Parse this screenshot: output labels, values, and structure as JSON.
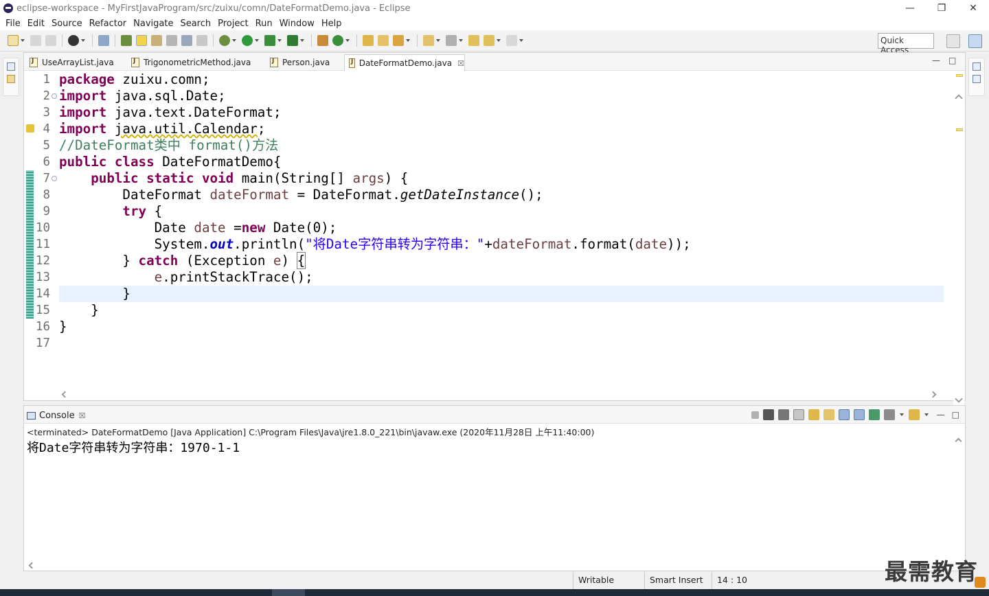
{
  "window": {
    "title": "eclipse-workspace - MyFirstJavaProgram/src/zuixu/comn/DateFormatDemo.java - Eclipse",
    "minimize": "—",
    "restore": "❐",
    "close": "✕"
  },
  "menu": [
    "File",
    "Edit",
    "Source",
    "Refactor",
    "Navigate",
    "Search",
    "Project",
    "Run",
    "Window",
    "Help"
  ],
  "toolbar": {
    "quick_access_placeholder": "Quick Access"
  },
  "editor": {
    "tabs": [
      {
        "label": "UseArrayList.java",
        "active": false
      },
      {
        "label": "TrigonometricMethod.java",
        "active": false
      },
      {
        "label": "Person.java",
        "active": false
      },
      {
        "label": "DateFormatDemo.java",
        "active": true
      }
    ],
    "tab_close": "☒",
    "minimize": "—",
    "maximize": "□",
    "line_numbers": [
      "1",
      "2",
      "3",
      "4",
      "5",
      "6",
      "7",
      "8",
      "9",
      "10",
      "11",
      "12",
      "13",
      "14",
      "15",
      "16",
      "17"
    ],
    "code": {
      "l1": {
        "kw": "package",
        "rest": " zuixu.comn;"
      },
      "l2": {
        "kw": "import",
        "rest": " java.sql.Date;"
      },
      "l3": {
        "kw": "import",
        "rest": " java.text.DateFormat;"
      },
      "l4": {
        "kw": "import",
        "warn": "java.util.Calendar",
        "rest": ";"
      },
      "l5": {
        "comment": "//DateFormat类中 format()方法"
      },
      "l6": {
        "kw1": "public",
        "kw2": "class",
        "rest": " DateFormatDemo{"
      },
      "l7": {
        "indent": "    ",
        "kw1": "public",
        "kw2": "static",
        "kw3": "void",
        "a": " main(String[] ",
        "var": "args",
        "b": ") {"
      },
      "l8": {
        "indent": "        ",
        "type": "DateFormat ",
        "var": "dateFormat",
        "eq": " = DateFormat.",
        "method": "getDateInstance",
        "end": "();"
      },
      "l9": {
        "indent": "        ",
        "kw": "try",
        "rest": " {"
      },
      "l10": {
        "indent": "            ",
        "type": "Date ",
        "var": "date",
        "eq": " =",
        "kw": "new",
        "rest": " Date(0);"
      },
      "l11": {
        "indent": "            ",
        "a": "System.",
        "fld": "out",
        "b": ".println(",
        "str": "\"将Date字符串转为字符串：\"",
        "c": "+",
        "var1": "dateFormat",
        "d": ".format(",
        "var2": "date",
        "e": "));"
      },
      "l12": {
        "indent": "        ",
        "a": "} ",
        "kw": "catch",
        "b": " (Exception ",
        "var": "e",
        "c": ") ",
        "brk": "{"
      },
      "l13": {
        "indent": "            ",
        "var": "e",
        "rest": ".printStackTrace();"
      },
      "l14": {
        "indent": "        ",
        "rest": "}"
      },
      "l15": {
        "indent": "    ",
        "rest": "}"
      },
      "l16": {
        "rest": "}"
      },
      "l17": {
        "rest": ""
      }
    }
  },
  "console": {
    "tab_label": "Console",
    "tab_close": "☒",
    "terminated": "<terminated> DateFormatDemo [Java Application] C:\\Program Files\\Java\\jre1.8.0_221\\bin\\javaw.exe (2020年11月28日 上午11:40:00)",
    "output": "将Date字符串转为字符串：1970-1-1",
    "minimize": "—",
    "maximize": "□"
  },
  "status": {
    "writable": "Writable",
    "insert_mode": "Smart Insert",
    "position": "14 : 10"
  },
  "watermark": "最需教育",
  "colors": {
    "keyword": "#7f0055",
    "comment": "#3f7f5f",
    "string": "#2a00ff",
    "field": "#0000c0",
    "variable": "#6a3e3e",
    "current_line": "#e8f2fe"
  }
}
